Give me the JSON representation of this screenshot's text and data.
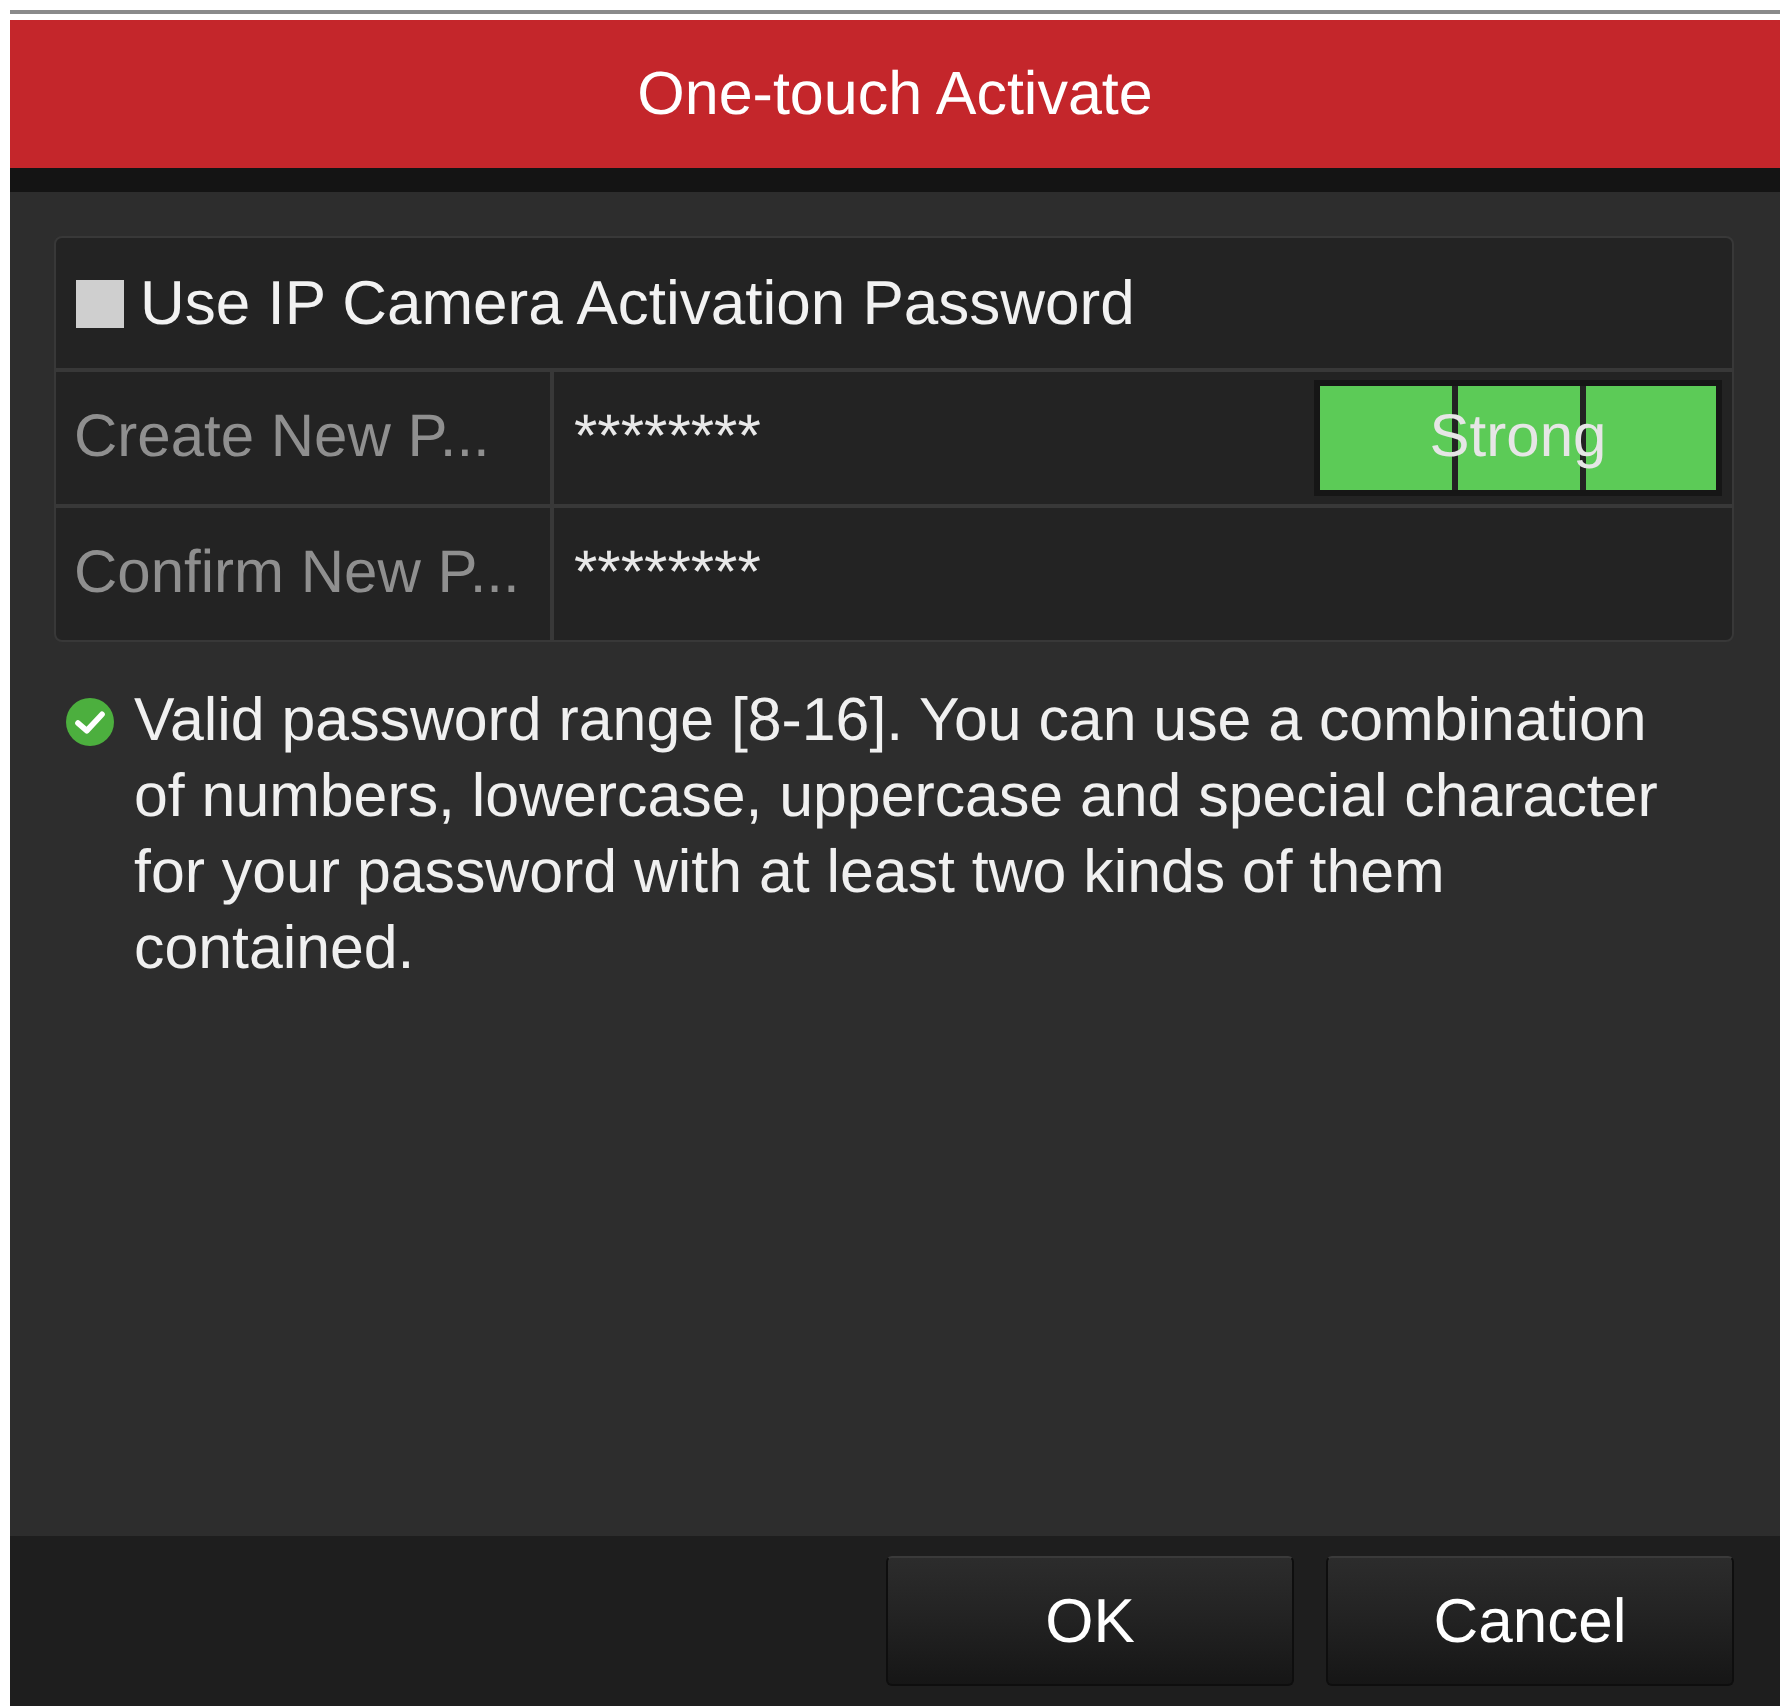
{
  "window": {
    "title": "One-touch Activate"
  },
  "use_activation_password": {
    "label": "Use IP Camera Activation Password",
    "checked": false
  },
  "fields": [
    {
      "label": "Create New P...",
      "value": "********",
      "strength": {
        "label": "Strong",
        "level": 1
      }
    },
    {
      "label": "Confirm New P...",
      "value": "********"
    }
  ],
  "hint": {
    "text": "Valid password range [8-16]. You can use a combination of numbers, lowercase, uppercase and special character for your password with at least two kinds of them contained."
  },
  "buttons": [
    {
      "label": "OK"
    },
    {
      "label": "Cancel"
    }
  ]
}
